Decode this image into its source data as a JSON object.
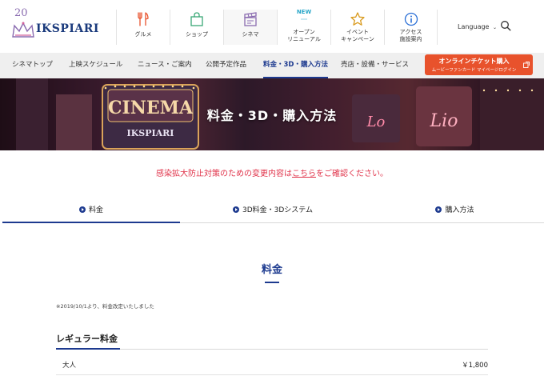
{
  "header": {
    "logo_number": "20",
    "logo_text": "IKSPIARI",
    "nav": [
      {
        "label": "グルメ",
        "icon": "fork-knife-icon",
        "color": "#e8522c"
      },
      {
        "label": "ショップ",
        "icon": "shopping-bag-icon",
        "color": "#3aa876"
      },
      {
        "label": "シネマ",
        "icon": "clapperboard-icon",
        "color": "#8a6bb0"
      },
      {
        "label_line1": "オープン",
        "label_line2": "リニューアル",
        "badge": "NEW",
        "icon": "new-badge-icon",
        "color": "#2aa7c9"
      },
      {
        "label_line1": "イベント",
        "label_line2": "キャンペーン",
        "icon": "star-icon",
        "color": "#d99a1e"
      },
      {
        "label_line1": "アクセス",
        "label_line2": "施設案内",
        "icon": "info-icon",
        "color": "#2a6fd6"
      }
    ],
    "language_label": "Language",
    "search_icon": "search-icon"
  },
  "subnav": {
    "items": [
      "シネマトップ",
      "上映スケジュール",
      "ニュース・ご案内",
      "公開予定作品",
      "料金・3D・購入方法",
      "売店・設備・サービス"
    ],
    "active_index": 4,
    "ticket_button": {
      "label": "オンラインチケット購入",
      "sub_label": "ムービーファンカード マイページログイン",
      "color": "#e8522c"
    }
  },
  "hero": {
    "title": "料金・3D・購入方法",
    "sign_cinema": "CINEMA",
    "sign_ikspiari": "IKSPIARI"
  },
  "notice": {
    "before": "感染拡大防止対策のための変更内容は",
    "link": "こちら",
    "after": "をご確認ください。"
  },
  "tabs": [
    {
      "label": "料金",
      "active": true
    },
    {
      "label": "3D料金・3Dシステム",
      "active": false
    },
    {
      "label": "購入方法",
      "active": false
    }
  ],
  "section": {
    "title": "料金",
    "note": "※2019/10/1より、料金改定いたしました",
    "subsection_title": "レギュラー料金",
    "prices": [
      {
        "label": "大人",
        "value": "￥1,800"
      }
    ]
  },
  "colors": {
    "accent_blue": "#1d3a8f",
    "notice_red": "#e0334a",
    "ticket_orange": "#e8522c"
  }
}
